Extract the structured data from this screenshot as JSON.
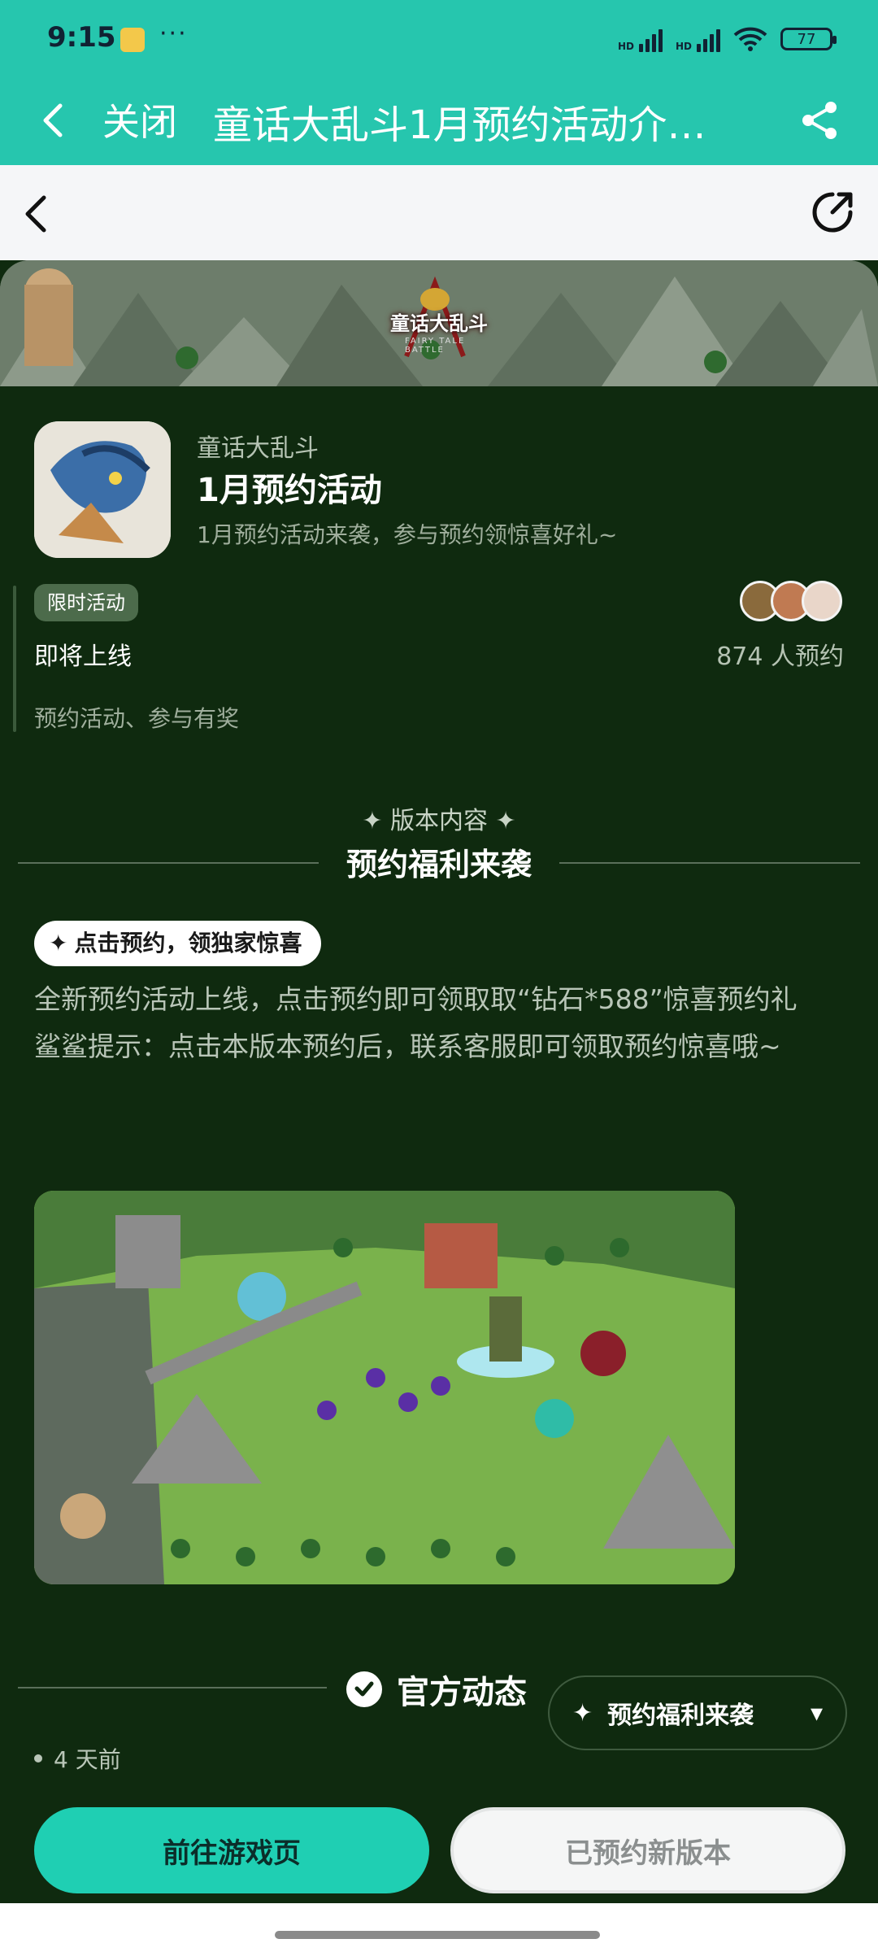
{
  "status_bar": {
    "time": "9:15",
    "dots": "···",
    "signal_hd_1": "HD",
    "signal_hd_2": "HD",
    "battery": "77"
  },
  "title_bar": {
    "close_label": "关闭",
    "title": "童话大乱斗1月预约活动介…"
  },
  "hero": {
    "logo_text": "童话大乱斗",
    "logo_sub": "FAIRY TALE BATTLE"
  },
  "event": {
    "game_name": "童话大乱斗",
    "title": "1月预约活动",
    "description": "1月预约活动来袭，参与预约领惊喜好礼~",
    "tag": "限时活动",
    "status": "即将上线",
    "reserve_count": "874 人预约",
    "note": "预约活动、参与有奖"
  },
  "section": {
    "sub": "✦ 版本内容 ✦",
    "title": "预约福利来袭"
  },
  "content": {
    "pill": "点击预约，领独家惊喜",
    "paragraph_1": "全新预约活动上线，点击预约即可领取取“钻石*588”惊喜预约礼",
    "paragraph_2": "鲨鲨提示：点击本版本预约后，联系客服即可领取预约惊喜哦~"
  },
  "official": {
    "title": "官方动态",
    "time": "4 天前",
    "float_chip": "预约福利来袭"
  },
  "actions": {
    "goto_game": "前往游戏页",
    "reserved": "已预约新版本"
  },
  "colors": {
    "accent": "#26c6ae",
    "background": "#0f2a0f",
    "button_primary": "#1fcfb3"
  }
}
